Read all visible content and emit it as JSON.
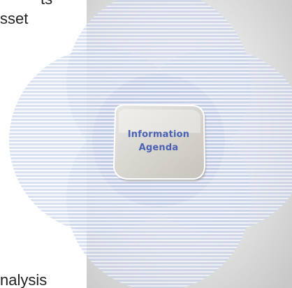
{
  "left_text": {
    "line_1": "ts",
    "line_2": "sset",
    "line_bottom": "nalysis"
  },
  "center": {
    "line_1": "Information",
    "line_2": "Agenda"
  },
  "colors": {
    "petal_fill": "#c9d3ea",
    "stripe": "#ffffff",
    "center_fill": "#d8d5cf",
    "center_text": "#4a62b4",
    "text": "#222222"
  }
}
